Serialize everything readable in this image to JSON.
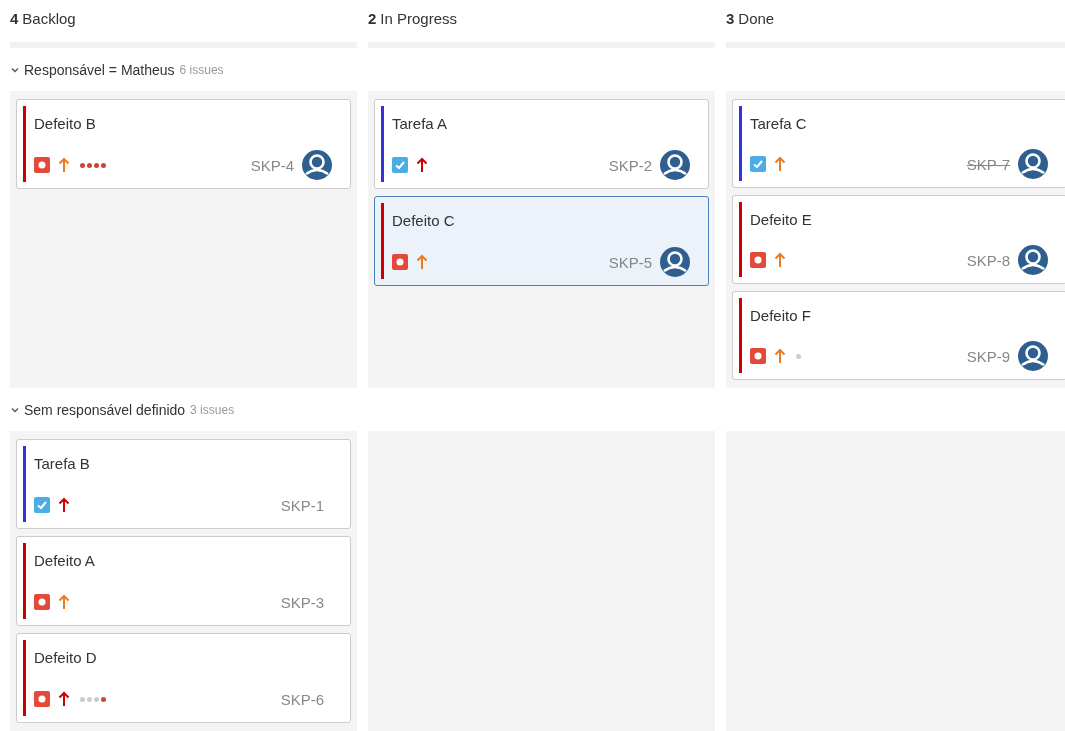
{
  "columns": [
    {
      "count": "4",
      "name": "Backlog"
    },
    {
      "count": "2",
      "name": "In Progress"
    },
    {
      "count": "3",
      "name": "Done"
    }
  ],
  "swimlanes": [
    {
      "title": "Responsável = Matheus",
      "count": "6 issues",
      "expanded": true,
      "columns": [
        [
          {
            "kind": "bug",
            "title": "Defeito B",
            "key": "SKP-4",
            "color": "#ee7a1e",
            "resolved": false,
            "assignee": true,
            "selected": false,
            "dots": [
              {
                "color": "#d04437"
              },
              {
                "color": "#d04437"
              },
              {
                "color": "#d04437"
              },
              {
                "color": "#d04437"
              }
            ]
          }
        ],
        [
          {
            "kind": "task",
            "title": "Tarefa A",
            "key": "SKP-2",
            "color": "#cc0000",
            "resolved": false,
            "assignee": true,
            "selected": false
          },
          {
            "kind": "bug",
            "title": "Defeito C",
            "key": "SKP-5",
            "color": "#ee7a1e",
            "resolved": false,
            "assignee": true,
            "selected": true
          }
        ],
        [
          {
            "kind": "task",
            "title": "Tarefa C",
            "key": "SKP-7",
            "color": "#ee7a1e",
            "resolved": true,
            "assignee": true,
            "selected": false
          },
          {
            "kind": "bug",
            "title": "Defeito E",
            "key": "SKP-8",
            "color": "#ee7a1e",
            "resolved": false,
            "assignee": true,
            "selected": false
          },
          {
            "kind": "bug",
            "title": "Defeito F",
            "key": "SKP-9",
            "color": "#ee7a1e",
            "resolved": false,
            "assignee": true,
            "selected": false,
            "dots": [
              {
                "color": "#cccccc"
              }
            ]
          }
        ]
      ]
    },
    {
      "title": "Sem responsável definido",
      "count": "3 issues",
      "expanded": true,
      "columns": [
        [
          {
            "kind": "task",
            "title": "Tarefa B",
            "key": "SKP-1",
            "color": "#cc0000",
            "resolved": false,
            "assignee": false,
            "selected": false
          },
          {
            "kind": "bug",
            "title": "Defeito A",
            "key": "SKP-3",
            "color": "#ee7a1e",
            "resolved": false,
            "assignee": false,
            "selected": false
          },
          {
            "kind": "bug",
            "title": "Defeito D",
            "key": "SKP-6",
            "color": "#cc0000",
            "resolved": false,
            "assignee": false,
            "selected": false,
            "dots": [
              {
                "color": "#cccccc"
              },
              {
                "color": "#cccccc"
              },
              {
                "color": "#cccccc"
              },
              {
                "color": "#d04437"
              }
            ]
          }
        ],
        [],
        []
      ]
    }
  ]
}
